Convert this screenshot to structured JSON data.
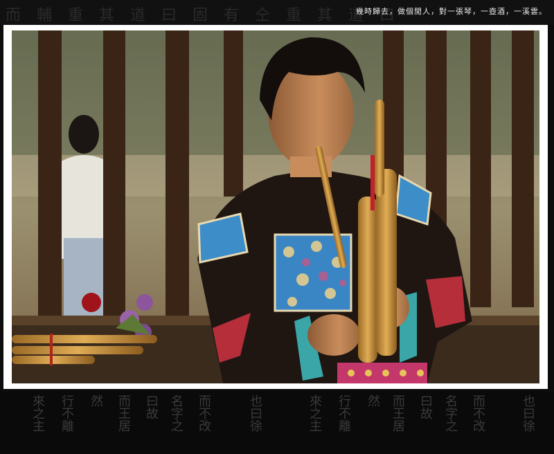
{
  "caption": "幾時歸去，做個閒人，對一張琴，一壺酒，一溪雲。",
  "top_watermark": "而 輔 重 其 道 曰 固 有 仝 重 其 道 曰 固 有",
  "bottom_calligraphy": [
    "來之主",
    "行不離",
    "然",
    "而王居",
    "曰故",
    "名字之",
    "而不改",
    "也曰徐",
    "來之主",
    "行不離",
    "然",
    "而王居",
    "曰故",
    "名字之",
    "而不改",
    "也曰徐"
  ],
  "colors": {
    "frame": "#ffffff",
    "background": "#0d0d0d",
    "jacket": "#1f1612",
    "embroidery": "#3d8dc9",
    "bamboo": "#c9953f"
  },
  "photo": {
    "subject": "young person playing a bamboo wind instrument behind a wooden railing"
  }
}
